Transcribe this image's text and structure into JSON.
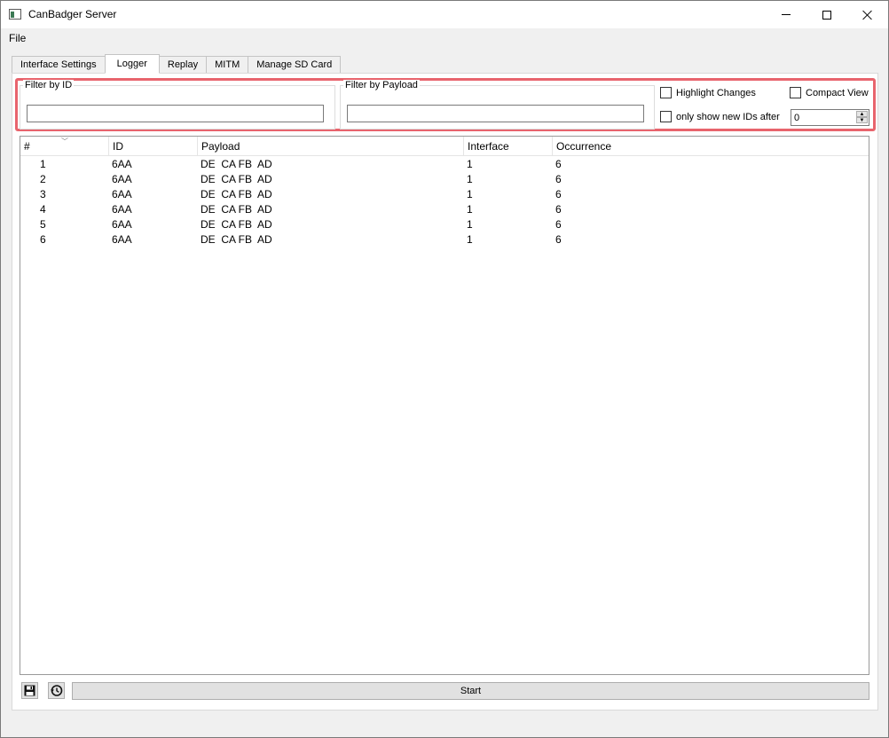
{
  "window": {
    "title": "CanBadger Server"
  },
  "menu": {
    "file": "File"
  },
  "tabs": [
    {
      "label": "Interface Settings",
      "active": false
    },
    {
      "label": "Logger",
      "active": true
    },
    {
      "label": "Replay",
      "active": false
    },
    {
      "label": "MITM",
      "active": false
    },
    {
      "label": "Manage SD Card",
      "active": false
    }
  ],
  "filters": {
    "by_id": {
      "label": "Filter by ID",
      "value": ""
    },
    "by_payload": {
      "label": "Filter by Payload",
      "value": ""
    },
    "highlight_changes": {
      "label": "Highlight Changes",
      "checked": false
    },
    "compact_view": {
      "label": "Compact View",
      "checked": false
    },
    "only_new_ids": {
      "label": "only show new IDs after",
      "checked": false
    },
    "spin_value": "0"
  },
  "table": {
    "columns": [
      "#",
      "ID",
      "Payload",
      "Interface",
      "Occurrence"
    ],
    "rows": [
      [
        "1",
        "6AA",
        "DE  CA FB  AD",
        "1",
        "6"
      ],
      [
        "2",
        "6AA",
        "DE  CA FB  AD",
        "1",
        "6"
      ],
      [
        "3",
        "6AA",
        "DE  CA FB  AD",
        "1",
        "6"
      ],
      [
        "4",
        "6AA",
        "DE  CA FB  AD",
        "1",
        "6"
      ],
      [
        "5",
        "6AA",
        "DE  CA FB  AD",
        "1",
        "6"
      ],
      [
        "6",
        "6AA",
        "DE  CA FB  AD",
        "1",
        "6"
      ]
    ]
  },
  "controls": {
    "save_icon": "floppy-disk-icon",
    "history_icon": "history-clock-icon",
    "start_label": "Start"
  },
  "colors": {
    "highlight_border": "#e8646d"
  }
}
